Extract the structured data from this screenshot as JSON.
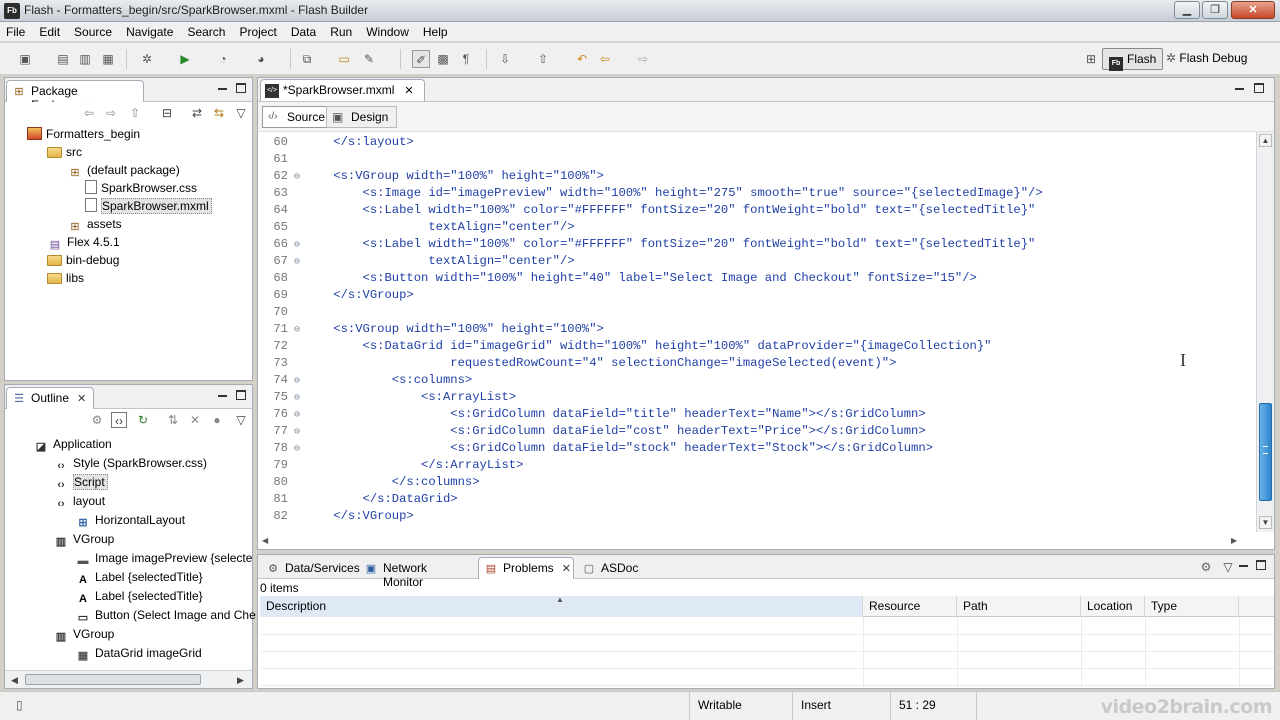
{
  "window": {
    "title": "Flash - Formatters_begin/src/SparkBrowser.mxml - Flash Builder",
    "app_icon": "Fb",
    "min_label": "▁",
    "max_label": "❐",
    "close_label": "✕"
  },
  "menu": [
    "File",
    "Edit",
    "Source",
    "Navigate",
    "Search",
    "Project",
    "Data",
    "Run",
    "Window",
    "Help"
  ],
  "perspectives": {
    "flash": "Flash",
    "flash_icon": "Fb",
    "flash_debug": "Flash Debug"
  },
  "package_explorer": {
    "title": "Package Explorer",
    "close": "✕",
    "items": [
      {
        "label": "Formatters_begin",
        "icon": "project-icon"
      },
      {
        "label": "src",
        "icon": "folder-icon"
      },
      {
        "label": "(default package)",
        "icon": "package-icon"
      },
      {
        "label": "SparkBrowser.css",
        "icon": "css-file-icon"
      },
      {
        "label": "SparkBrowser.mxml",
        "icon": "mxml-file-icon"
      },
      {
        "label": "assets",
        "icon": "package-icon"
      },
      {
        "label": "Flex 4.5.1",
        "icon": "library-icon"
      },
      {
        "label": "bin-debug",
        "icon": "folder-icon"
      },
      {
        "label": "libs",
        "icon": "folder-icon"
      }
    ]
  },
  "outline": {
    "title": "Outline",
    "close": "✕",
    "items": [
      {
        "label": "Application",
        "icon": "application-icon"
      },
      {
        "label": "Style (SparkBrowser.css)",
        "icon": "code-icon"
      },
      {
        "label": "Script",
        "icon": "code-icon"
      },
      {
        "label": "layout",
        "icon": "code-icon"
      },
      {
        "label": "HorizontalLayout",
        "icon": "layout-icon"
      },
      {
        "label": "VGroup",
        "icon": "vgroup-icon"
      },
      {
        "label": "Image imagePreview {selecte",
        "icon": "image-icon"
      },
      {
        "label": "Label {selectedTitle}",
        "icon": "label-icon"
      },
      {
        "label": "Label {selectedTitle}",
        "icon": "label-icon"
      },
      {
        "label": "Button (Select Image and Che",
        "icon": "button-icon"
      },
      {
        "label": "VGroup",
        "icon": "vgroup-icon"
      },
      {
        "label": "DataGrid imageGrid",
        "icon": "datagrid-icon"
      }
    ]
  },
  "editor": {
    "tab_label": "*SparkBrowser.mxml",
    "close": "✕",
    "source_label": "Source",
    "design_label": "Design",
    "lines": [
      {
        "n": "60",
        "text": "    </s:layout>"
      },
      {
        "n": "61",
        "text": ""
      },
      {
        "n": "62",
        "text": "    <s:VGroup width=\"100%\" height=\"100%\">"
      },
      {
        "n": "63",
        "text": "        <s:Image id=\"imagePreview\" width=\"100%\" height=\"275\" smooth=\"true\" source=\"{selectedImage}\"/>"
      },
      {
        "n": "64",
        "text": "        <s:Label width=\"100%\" color=\"#FFFFFF\" fontSize=\"20\" fontWeight=\"bold\" text=\"{selectedTitle}\""
      },
      {
        "n": "65",
        "text": "                 textAlign=\"center\"/>"
      },
      {
        "n": "66",
        "text": "        <s:Label width=\"100%\" color=\"#FFFFFF\" fontSize=\"20\" fontWeight=\"bold\" text=\"{selectedTitle}\""
      },
      {
        "n": "67",
        "text": "                 textAlign=\"center\"/>"
      },
      {
        "n": "68",
        "text": "        <s:Button width=\"100%\" height=\"40\" label=\"Select Image and Checkout\" fontSize=\"15\"/>"
      },
      {
        "n": "69",
        "text": "    </s:VGroup>"
      },
      {
        "n": "70",
        "text": ""
      },
      {
        "n": "71",
        "text": "    <s:VGroup width=\"100%\" height=\"100%\">"
      },
      {
        "n": "72",
        "text": "        <s:DataGrid id=\"imageGrid\" width=\"100%\" height=\"100%\" dataProvider=\"{imageCollection}\""
      },
      {
        "n": "73",
        "text": "                    requestedRowCount=\"4\" selectionChange=\"imageSelected(event)\">"
      },
      {
        "n": "74",
        "text": "            <s:columns>"
      },
      {
        "n": "75",
        "text": "                <s:ArrayList>"
      },
      {
        "n": "76",
        "text": "                    <s:GridColumn dataField=\"title\" headerText=\"Name\"></s:GridColumn>"
      },
      {
        "n": "77",
        "text": "                    <s:GridColumn dataField=\"cost\" headerText=\"Price\"></s:GridColumn>"
      },
      {
        "n": "78",
        "text": "                    <s:GridColumn dataField=\"stock\" headerText=\"Stock\"></s:GridColumn>"
      },
      {
        "n": "79",
        "text": "                </s:ArrayList>"
      },
      {
        "n": "80",
        "text": "            </s:columns>"
      },
      {
        "n": "81",
        "text": "        </s:DataGrid>"
      },
      {
        "n": "82",
        "text": "    </s:VGroup>"
      }
    ]
  },
  "bottom_panel": {
    "tabs": [
      "Data/Services",
      "Network Monitor",
      "Problems",
      "ASDoc"
    ],
    "close": "✕",
    "items_count": "0 items",
    "columns": [
      "Description",
      "Resource",
      "Path",
      "Location",
      "Type"
    ]
  },
  "status": {
    "writable": "Writable",
    "insert": "Insert",
    "position": "51 : 29"
  },
  "watermark": "video2brain.com"
}
